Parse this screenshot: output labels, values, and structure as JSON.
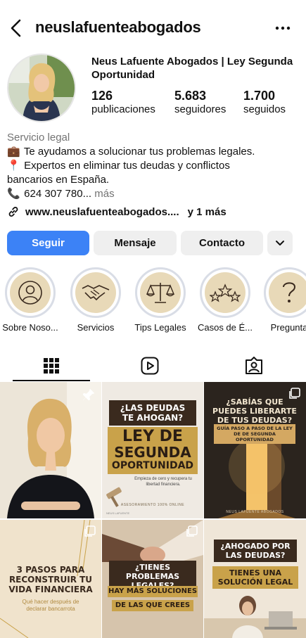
{
  "header": {
    "username": "neuslafuenteabogados"
  },
  "profile": {
    "display_name": "Neus Lafuente Abogados | Ley Segunda Oportunidad",
    "stats": [
      {
        "value": "126",
        "label": "publicaciones"
      },
      {
        "value": "5.683",
        "label": "seguidores"
      },
      {
        "value": "1.700",
        "label": "seguidos"
      }
    ],
    "category": "Servicio legal",
    "bio_lines": [
      {
        "emoji": "💼",
        "text": "Te ayudamos a solucionar tus problemas legales."
      },
      {
        "emoji": "📍",
        "text": "Expertos en eliminar tus deudas y conflictos"
      },
      {
        "emoji": "",
        "text": "bancarios en España."
      },
      {
        "emoji": "📞",
        "text": "624 307 780..."
      }
    ],
    "bio_more": " más",
    "link": {
      "url": "www.neuslafuenteabogados....",
      "extra": "y 1 más"
    }
  },
  "actions": {
    "follow": "Seguir",
    "message": "Mensaje",
    "contact": "Contacto"
  },
  "highlights": [
    {
      "label": "Sobre Noso...",
      "icon": "person-icon"
    },
    {
      "label": "Servicios",
      "icon": "handshake-icon"
    },
    {
      "label": "Tips Legales",
      "icon": "scales-icon"
    },
    {
      "label": "Casos de É...",
      "icon": "stars-icon"
    },
    {
      "label": "Pregunta",
      "icon": "question-icon"
    }
  ],
  "tabs": [
    {
      "name": "grid",
      "icon": "grid-icon"
    },
    {
      "name": "reels",
      "icon": "reels-icon"
    },
    {
      "name": "tagged",
      "icon": "tagged-icon"
    }
  ],
  "posts": {
    "p2": {
      "line1": "¿LAS DEUDAS",
      "line2": "TE AHOGAN?",
      "big1": "LEY DE",
      "big2": "SEGUNDA",
      "big3": "OPORTUNIDAD",
      "sub": "Empieza de cero y recupera tu libertad financiera.",
      "footer": "ASESORAMIENTO 100% ONLINE",
      "small": "NEUS LAFUENTE"
    },
    "p3": {
      "title": "¿SABÍAS QUE PUEDES LIBERARTE DE TUS DEUDAS?",
      "sub": "GUÍA PASO A PASO DE LA LEY DE DE SEGUNDA OPORTUNIDAD",
      "footer": "NEUS LAFUENTE ABOGADOS"
    },
    "p4": {
      "title": "3 PASOS PARA RECONSTRUIR TU VIDA FINANCIERA",
      "sub": "Qué hacer después de declarar bancarrota"
    },
    "p5": {
      "title": "¿TIENES PROBLEMAS LEGALES?",
      "sub1": "HAY MÁS SOLUCIONES",
      "sub2": "DE LAS QUE CREES"
    },
    "p6": {
      "title1": "¿AHOGADO POR",
      "title2": "LAS DEUDAS?",
      "sub1": "TIENES UNA",
      "sub2": "SOLUCIÓN LEGAL"
    }
  },
  "colors": {
    "follow_blue": "#3c82f6",
    "highlight_bg": "#e8d9b8",
    "gold": "#c9a24a",
    "dark_brown": "#3a2a1e",
    "muted": "#737373"
  }
}
